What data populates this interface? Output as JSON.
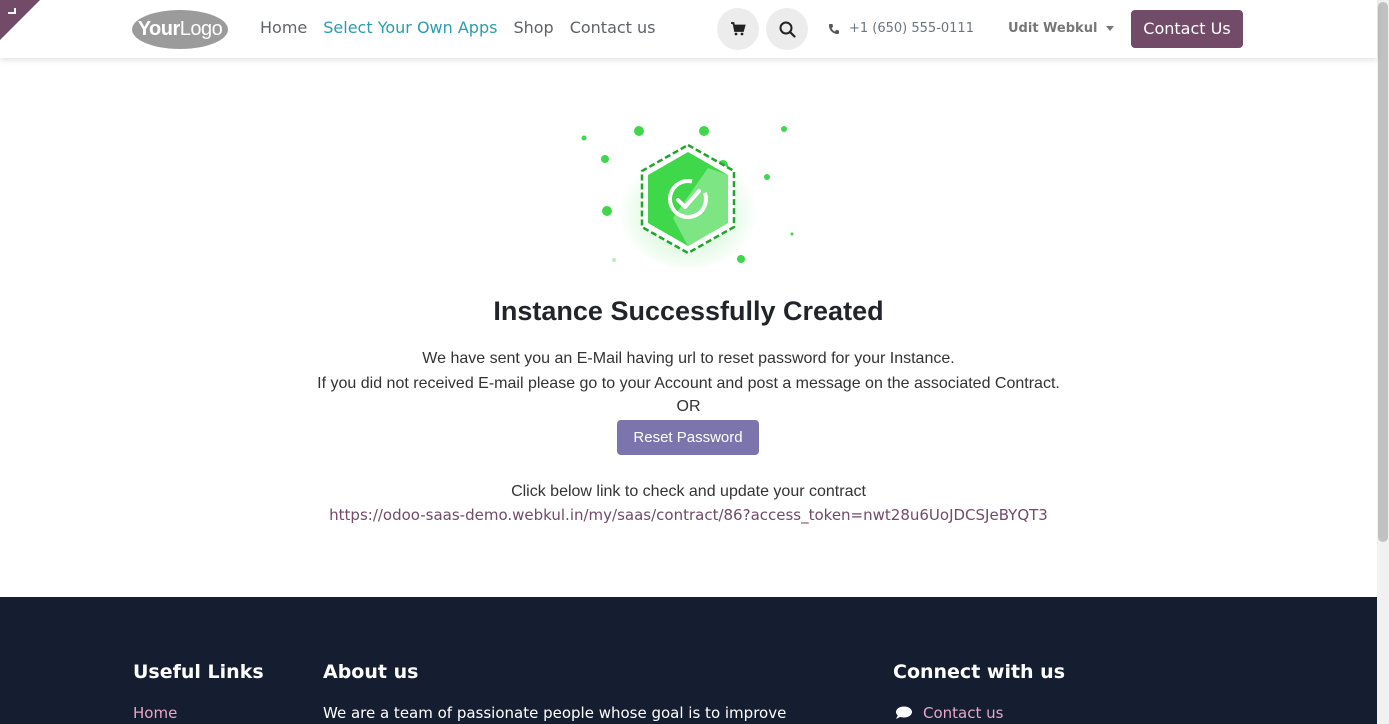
{
  "header": {
    "logo": {
      "part1": "Your",
      "part2": "Logo"
    },
    "nav": [
      {
        "label": "Home",
        "active": false
      },
      {
        "label": "Select Your Own Apps",
        "active": true
      },
      {
        "label": "Shop",
        "active": false
      },
      {
        "label": "Contact us",
        "active": false
      }
    ],
    "cart_icon": "cart-icon",
    "search_icon": "search-icon",
    "phone_icon": "phone-icon",
    "phone": "+1 (650) 555-0111",
    "user": "Udit Webkul",
    "cta_label": "Contact Us",
    "accent_color": "#714b67",
    "active_nav_color": "#2b9dac"
  },
  "main": {
    "title": "Instance Successfully Created",
    "line1": "We have sent you an E-Mail having url to reset password for your Instance.",
    "line2": "If you did not received E-mail please go to your Account and post a message on the associated Contract.",
    "or": "OR",
    "reset_button": "Reset Password",
    "check_text": "Click below link to check and update your contract",
    "contract_link": "https://odoo-saas-demo.webkul.in/my/saas/contract/86?access_token=nwt28u6UoJDCSJeBYQT3",
    "success_color": "#3fd84a",
    "button_color": "#7c74ac"
  },
  "footer": {
    "useful_links_title": "Useful Links",
    "useful_links_first": "Home",
    "about_title": "About us",
    "about_text": "We are a team of passionate people whose goal is to improve",
    "connect_title": "Connect with us",
    "connect_first": "Contact us",
    "background": "#151d30"
  }
}
